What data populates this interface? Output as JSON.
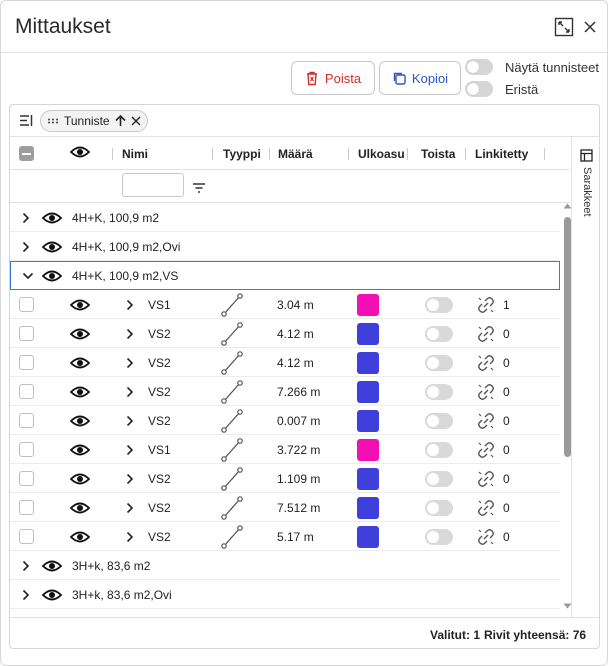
{
  "title": "Mittaukset",
  "toolbar": {
    "delete_label": "Poista",
    "copy_label": "Kopioi"
  },
  "toggles": {
    "show_ids_label": "Näytä tunnisteet",
    "isolate_label": "Eristä"
  },
  "group_chip": {
    "label": "Tunniste"
  },
  "columns": {
    "name": "Nimi",
    "type": "Tyyppi",
    "amount": "Määrä",
    "appearance": "Ulkoasu",
    "repeat": "Toista",
    "linked": "Linkitetty"
  },
  "side_panel": {
    "label": "Sarakkeet"
  },
  "groups": [
    {
      "label": "4H+K, 100,9 m2",
      "expanded": false
    },
    {
      "label": "4H+K, 100,9 m2,Ovi",
      "expanded": false
    },
    {
      "label": "4H+K, 100,9 m2,VS",
      "expanded": true
    }
  ],
  "rows": [
    {
      "name": "VS1",
      "amount": "3.04 m",
      "color": "#f20fb4",
      "linked": "1"
    },
    {
      "name": "VS2",
      "amount": "4.12 m",
      "color": "#3f3fdc",
      "linked": "0"
    },
    {
      "name": "VS2",
      "amount": "4.12 m",
      "color": "#3f3fdc",
      "linked": "0"
    },
    {
      "name": "VS2",
      "amount": "7.266 m",
      "color": "#3f3fdc",
      "linked": "0"
    },
    {
      "name": "VS2",
      "amount": "0.007 m",
      "color": "#3f3fdc",
      "linked": "0"
    },
    {
      "name": "VS1",
      "amount": "3.722 m",
      "color": "#f20fb4",
      "linked": "0"
    },
    {
      "name": "VS2",
      "amount": "1.109 m",
      "color": "#3f3fdc",
      "linked": "0"
    },
    {
      "name": "VS2",
      "amount": "7.512 m",
      "color": "#3f3fdc",
      "linked": "0"
    },
    {
      "name": "VS2",
      "amount": "5.17 m",
      "color": "#3f3fdc",
      "linked": "0"
    }
  ],
  "groups_after": [
    {
      "label": "3H+k, 83,6 m2"
    },
    {
      "label": "3H+k, 83,6 m2,Ovi"
    }
  ],
  "footer": {
    "selected": "Valitut: 1",
    "total": "Rivit yhteensä: 76"
  }
}
